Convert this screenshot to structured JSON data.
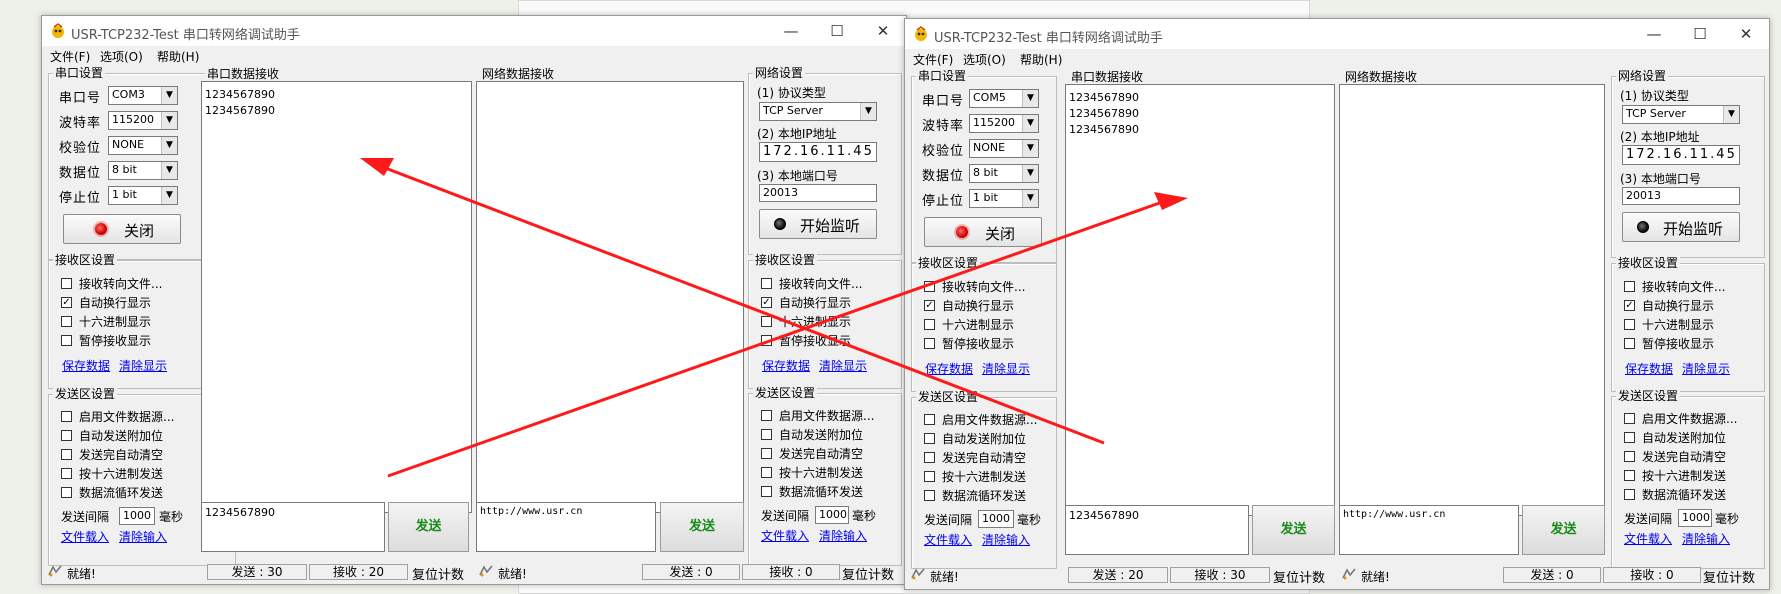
{
  "window_title": "USR-TCP232-Test 串口转网络调试助手",
  "window_controls": {
    "minimize": "—",
    "maximize": "☐",
    "close": "✕"
  },
  "menu": {
    "file": "文件(F)",
    "options": "选项(O)",
    "help": "帮助(H)"
  },
  "serial_settings": {
    "title": "串口设置",
    "port_label": "串口号",
    "baud_label": "波特率",
    "parity_label": "校验位",
    "databits_label": "数据位",
    "stopbits_label": "停止位",
    "close_button": "关闭"
  },
  "serial_recv_title": "串口数据接收",
  "net_recv_title": "网络数据接收",
  "net_settings": {
    "title": "网络设置",
    "protocol_label": "(1) 协议类型",
    "protocol_value": "TCP Server",
    "ip_label": "(2) 本地IP地址",
    "ip_value": "172.16.11.45",
    "port_label": "(3) 本地端口号",
    "port_value": "20013",
    "listen_button": "开始监听"
  },
  "recv_settings": {
    "title": "接收区设置",
    "opt_redirect_file": "接收转向文件...",
    "opt_auto_newline": "自动换行显示",
    "opt_hex_display": "十六进制显示",
    "opt_pause_display": "暂停接收显示",
    "link_save": "保存数据",
    "link_clear": "清除显示"
  },
  "send_settings": {
    "title": "发送区设置",
    "opt_file_source": "启用文件数据源...",
    "opt_append": "自动发送附加位",
    "opt_clear_after": "发送完自动清空",
    "opt_hex_send": "按十六进制发送",
    "opt_loop": "数据流循环发送",
    "interval_label": "发送间隔",
    "interval_value": "1000",
    "interval_unit": "毫秒",
    "link_load": "文件载入",
    "link_clear_input": "清除输入"
  },
  "send_button": "发送",
  "status": {
    "ready": "就绪!",
    "reset": "复位计数"
  },
  "left_window": {
    "serial_port": "COM3",
    "baud": "115200",
    "parity": "NONE",
    "data_bits": "8 bit",
    "stop_bits": "1 bit",
    "serial_recv_lines": [
      "1234567890",
      "1234567890"
    ],
    "serial_send_text": "1234567890",
    "net_send_text": "http://www.usr.cn",
    "serial_sent": "发送 : 30",
    "serial_received": "接收 : 20",
    "net_sent": "发送 : 0",
    "net_received": "接收 : 0"
  },
  "right_window": {
    "serial_port": "COM5",
    "baud": "115200",
    "parity": "NONE",
    "data_bits": "8 bit",
    "stop_bits": "1 bit",
    "serial_recv_lines": [
      "1234567890",
      "1234567890",
      "1234567890"
    ],
    "serial_send_text": "1234567890",
    "net_send_text": "http://www.usr.cn",
    "serial_sent": "发送 : 20",
    "serial_received": "接收 : 30",
    "net_sent": "发送 : 0",
    "net_received": "接收 : 0"
  },
  "colors": {
    "arrow": "#ff1a1a",
    "send_label": "#1a8a1a",
    "link": "#0000ee"
  },
  "icons": [
    "app-icon",
    "minimize-icon",
    "maximize-icon",
    "close-icon",
    "dropdown-arrow-icon",
    "red-led-icon",
    "black-led-icon",
    "status-icon",
    "red-arrow-annotation"
  ]
}
